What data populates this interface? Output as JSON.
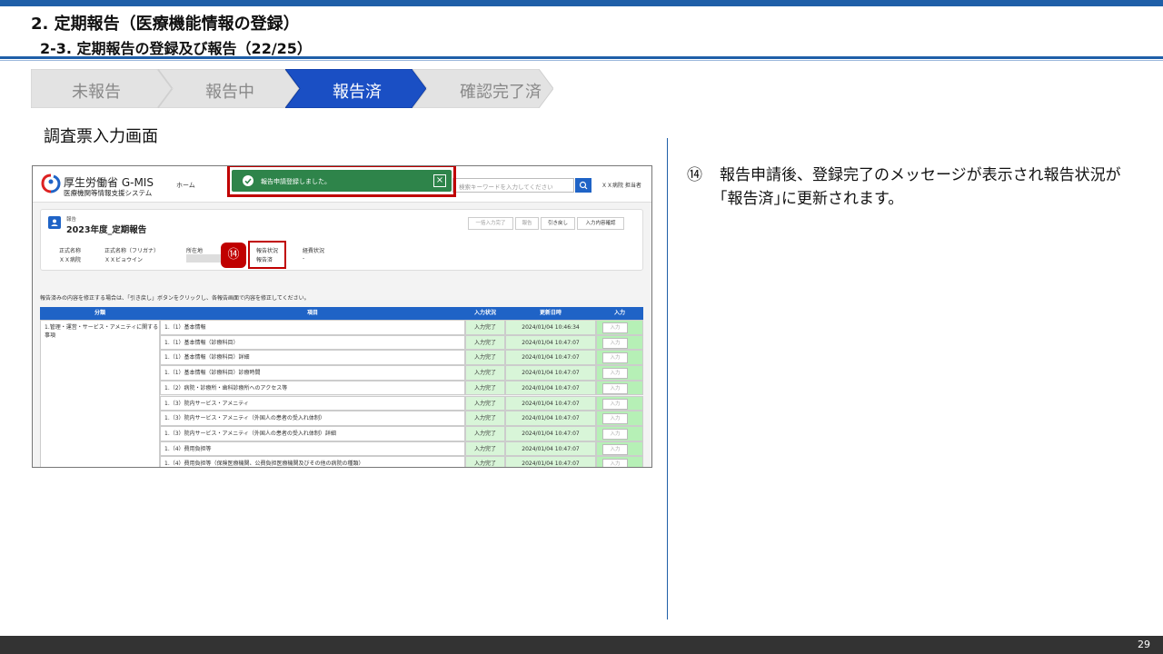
{
  "slide": {
    "title": "2. 定期報告（医療機能情報の登録）",
    "subtitle": "2-3. 定期報告の登録及び報告（22/25）",
    "section_label": "調査票入力画面",
    "page_number": "29"
  },
  "steps": [
    {
      "label": "未報告",
      "active": false
    },
    {
      "label": "報告中",
      "active": false
    },
    {
      "label": "報告済",
      "active": true
    },
    {
      "label": "確認完了済",
      "active": false
    }
  ],
  "description": {
    "number": "⑭",
    "text": "報告申請後、登録完了のメッセージが表示され報告状況が｢報告済｣に更新されます。"
  },
  "app": {
    "logo_title": "厚生労働省 G-MIS",
    "logo_subtitle": "医療機関等情報支援システム",
    "nav_home": "ホーム",
    "search_placeholder": "検索キーワードを入力してください",
    "user_name": "ＸＸ病院 担当者",
    "toast_message": "報告申請登録しました。",
    "annotation_number": "⑭",
    "card": {
      "kicker": "報告",
      "title": "2023年度_定期報告",
      "buttons": [
        "一括入力完了",
        "報告",
        "引き戻し",
        "入力内容確認"
      ],
      "fields": [
        {
          "label": "正式名称",
          "value": "ＸＸ病院"
        },
        {
          "label": "正式名称（フリガナ）",
          "value": "ＸＸビョウイン"
        },
        {
          "label": "所在地",
          "value": ""
        },
        {
          "label": "報告状況",
          "value": "報告済"
        },
        {
          "label": "経費状況",
          "value": "-"
        }
      ]
    },
    "note": "報告済みの内容を修正する場合は、「引き戻し」ボタンをクリックし、各報告画面で内容を修正してください。",
    "table": {
      "headers": [
        "分類",
        "項目",
        "入力状況",
        "更新日時",
        "入力"
      ],
      "category": "1.管理・運営・サービス・アメニティに関する事項",
      "input_button": "入力",
      "rows": [
        {
          "item": "1.（1）基本情報",
          "status": "入力完了",
          "date": "2024/01/04 10:46:34"
        },
        {
          "item": "1.（1）基本情報（診療科目）",
          "status": "入力完了",
          "date": "2024/01/04 10:47:07"
        },
        {
          "item": "1.（1）基本情報（診療科目）詳細",
          "status": "入力完了",
          "date": "2024/01/04 10:47:07"
        },
        {
          "item": "1.（1）基本情報（診療科目）診療時間",
          "status": "入力完了",
          "date": "2024/01/04 10:47:07"
        },
        {
          "item": "1.（2）病院・診療所・歯科診療所へのアクセス等",
          "status": "入力完了",
          "date": "2024/01/04 10:47:07"
        },
        {
          "item": "1.（3）院内サービス・アメニティ",
          "status": "入力完了",
          "date": "2024/01/04 10:47:07"
        },
        {
          "item": "1.（3）院内サービス・アメニティ（外国人の患者の受入れ体制）",
          "status": "入力完了",
          "date": "2024/01/04 10:47:07"
        },
        {
          "item": "1.（3）院内サービス・アメニティ（外国人の患者の受入れ体制）詳細",
          "status": "入力完了",
          "date": "2024/01/04 10:47:07"
        },
        {
          "item": "1.（4）費用負担等",
          "status": "入力完了",
          "date": "2024/01/04 10:47:07"
        },
        {
          "item": "1.（4）費用負担等（保険医療機関、公費負担医療機関及びその他の病院の種類）",
          "status": "入力完了",
          "date": "2024/01/04 10:47:07"
        }
      ]
    }
  },
  "colors": {
    "brand_blue": "#1f5fa8",
    "active_step": "#1a4fc4",
    "inactive_step": "#e3e3e3",
    "highlight_red": "#c00000",
    "toast_green": "#2e844a"
  }
}
